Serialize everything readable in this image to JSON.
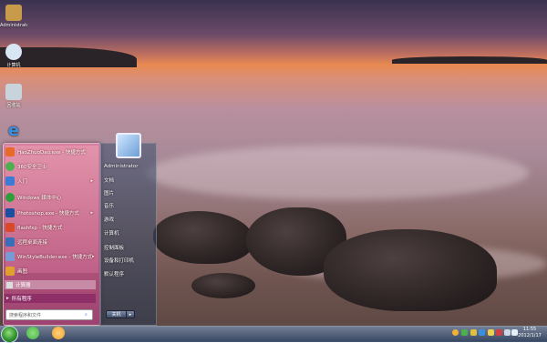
{
  "desktop": {
    "icons": [
      {
        "label": "Administrator",
        "icon": "user-folder-icon",
        "color": "#c89b4a"
      },
      {
        "label": "计算机",
        "icon": "computer-icon",
        "color": "#d8e6f4"
      },
      {
        "label": "回收站",
        "icon": "recycle-bin-icon",
        "color": "#c9d3dc"
      },
      {
        "label": "",
        "icon": "ie-icon",
        "color": "#3a8fde"
      }
    ]
  },
  "start_menu": {
    "programs": [
      {
        "label": "HaoZhuoDao.exe - 快捷方式",
        "icon": "app-icon",
        "color": "#e86a2a",
        "arrow": ""
      },
      {
        "label": "360安全卫士",
        "icon": "shield-icon",
        "color": "#4caf50",
        "arrow": ""
      },
      {
        "label": "入门",
        "icon": "getting-started-icon",
        "color": "#3b7bd6",
        "arrow": "▸"
      },
      {
        "label": "Windows 媒体中心",
        "icon": "media-center-icon",
        "color": "#2e9e3a",
        "arrow": ""
      },
      {
        "label": "Photoshop.exe - 快捷方式",
        "icon": "photoshop-icon",
        "color": "#1c4fa0",
        "arrow": "▸"
      },
      {
        "label": "flashfxp - 快捷方式",
        "icon": "ftp-icon",
        "color": "#d9482b",
        "arrow": ""
      },
      {
        "label": "远程桌面连接",
        "icon": "remote-desktop-icon",
        "color": "#3a6fb8",
        "arrow": ""
      },
      {
        "label": "WinStyleBuilder.exe - 快捷方式",
        "icon": "builder-icon",
        "color": "#7a9ad6",
        "arrow": "▸"
      },
      {
        "label": "画图",
        "icon": "paint-icon",
        "color": "#e0a030",
        "arrow": ""
      }
    ],
    "highlighted": "计算器",
    "all_programs": "所有程序",
    "search_placeholder": "搜索程序和文件",
    "right_items": [
      "Administrator",
      "文档",
      "图片",
      "音乐",
      "游戏",
      "计算机",
      "控制面板",
      "设备和打印机",
      "默认程序"
    ],
    "shutdown_label": "关机",
    "shutdown_arrow": "▸"
  },
  "taskbar": {
    "pinned": [
      {
        "icon": "360-browser-icon",
        "color": "#45b24a"
      },
      {
        "icon": "safe-icon",
        "color": "#f0a030"
      }
    ],
    "tray_icons": [
      {
        "icon": "tray-icon-1",
        "color": "#f2b233"
      },
      {
        "icon": "tray-icon-2",
        "color": "#4caf50"
      },
      {
        "icon": "tray-icon-3",
        "color": "#e0c040"
      },
      {
        "icon": "tray-icon-4",
        "color": "#3a8fde"
      },
      {
        "icon": "tray-icon-5",
        "color": "#f0d050"
      },
      {
        "icon": "tray-icon-6",
        "color": "#d04040"
      },
      {
        "icon": "network-icon",
        "color": "#cfd8e6"
      },
      {
        "icon": "volume-icon",
        "color": "#e6eef8"
      }
    ],
    "time": "11:55",
    "date": "2012/1/17"
  }
}
